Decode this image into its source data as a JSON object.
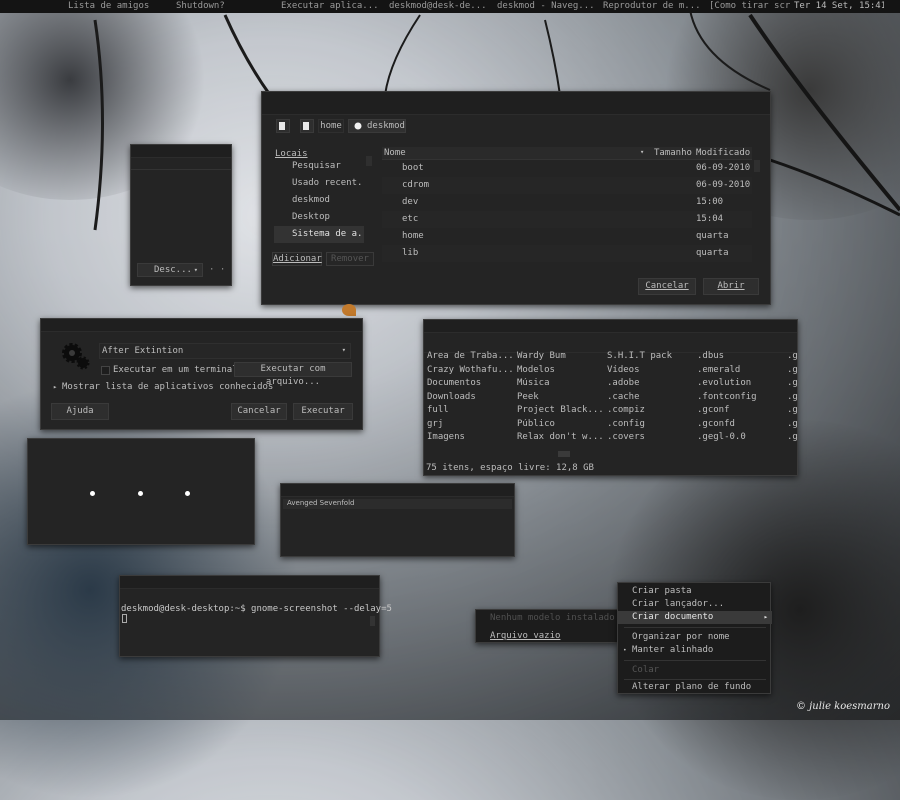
{
  "top_panel": {
    "tasks": [
      "Lista de amigos",
      "Shutdown?",
      "Executar aplica...",
      "deskmod@desk-de...",
      "deskmod - Naveg...",
      "Reprodutor de m...",
      "[Como tirar scr..."
    ],
    "clock": "Ter 14 Set, 15:41"
  },
  "file_chooser": {
    "path": [
      "home",
      "deskmod"
    ],
    "places_title": "Locais",
    "places": [
      "Pesquisar",
      "Usado recent...",
      "deskmod",
      "Desktop",
      "Sistema de a..."
    ],
    "add_label": "Adicionar",
    "remove_label": "Remover",
    "columns": {
      "name": "Nome",
      "size": "Tamanho",
      "modified": "Modificado"
    },
    "files": [
      {
        "name": "boot",
        "modified": "06-09-2010"
      },
      {
        "name": "cdrom",
        "modified": "06-09-2010"
      },
      {
        "name": "dev",
        "modified": "15:00"
      },
      {
        "name": "etc",
        "modified": "15:04"
      },
      {
        "name": "home",
        "modified": "quarta"
      },
      {
        "name": "lib",
        "modified": "quarta"
      }
    ],
    "cancel_label": "Cancelar",
    "open_label": "Abrir"
  },
  "small_window": {
    "dropdown": "Desc..."
  },
  "run_dialog": {
    "command": "After Extintion",
    "terminal_label": "Executar em um terminal",
    "file_button": "Executar com arquivo...",
    "show_list_label": "Mostrar lista de aplicativos conhecidos",
    "help_label": "Ajuda",
    "cancel_label": "Cancelar",
    "run_label": "Executar"
  },
  "nautilus": {
    "col1": [
      "Área de Traba...",
      "Crazy Wothafu...",
      "Documentos",
      "Downloads",
      "full",
      "grj",
      "Imagens"
    ],
    "col2": [
      "Wardy Bum",
      "Modelos",
      "Música",
      "Peek",
      "Project Black...",
      "Público",
      "Relax don't w..."
    ],
    "col3": [
      "S.H.I.T pack",
      "Vídeos",
      ".adobe",
      ".cache",
      ".compiz",
      ".config",
      ".covers"
    ],
    "col4": [
      ".dbus",
      ".emerald",
      ".evolution",
      ".fontconfig",
      ".gconf",
      ".gconfd",
      ".gegl-0.0"
    ],
    "col5": [
      ".g",
      ".g",
      ".g",
      ".g",
      ".g",
      ".g",
      ".g"
    ],
    "status": "75 itens, espaço livre: 12,8 GB"
  },
  "music_window": {
    "track": "Avenged Sevenfold"
  },
  "terminal": {
    "prompt": "deskmod@desk-desktop:~$ gnome-screenshot --delay=5"
  },
  "submenu": {
    "items": [
      "Nenhum modelo instalado",
      "Arquivo vazio"
    ]
  },
  "context_menu": {
    "items": [
      "Criar pasta",
      "Criar lançador...",
      "Criar documento",
      "Organizar por nome",
      "Manter alinhado",
      "Colar",
      "Alterar plano de fundo"
    ]
  },
  "watermark": "© julie koesmarno"
}
